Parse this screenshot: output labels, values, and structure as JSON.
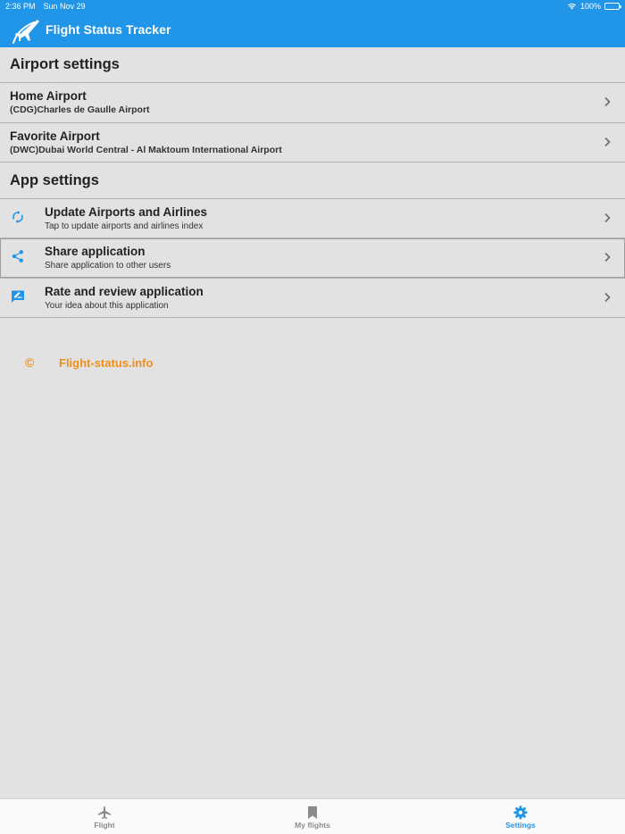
{
  "status_bar": {
    "time": "2:36 PM",
    "date": "Sun Nov 29",
    "battery": "100%"
  },
  "header": {
    "title": "Flight Status Tracker",
    "color": "#2196e8"
  },
  "airport_settings": {
    "title": "Airport settings",
    "items": [
      {
        "label": "Home Airport",
        "value": "(CDG)Charles de Gaulle Airport"
      },
      {
        "label": "Favorite Airport",
        "value": "(DWC)Dubai World Central - Al Maktoum International Airport"
      }
    ]
  },
  "app_settings": {
    "title": "App settings",
    "items": [
      {
        "label": "Update Airports and Airlines",
        "description": "Tap to update airports and airlines index",
        "icon": "sync-icon"
      },
      {
        "label": "Share application",
        "description": "Share application to other users",
        "icon": "share-icon"
      },
      {
        "label": "Rate and review application",
        "description": "Your idea about this application",
        "icon": "rate-review-icon"
      }
    ]
  },
  "copyright": {
    "symbol": "©",
    "text": "Flight-status.info",
    "color": "#ee8f1b"
  },
  "tabs": [
    {
      "label": "Flight",
      "icon": "airplane-icon",
      "active": false
    },
    {
      "label": "My flights",
      "icon": "bookmark-icon",
      "active": false
    },
    {
      "label": "Settings",
      "icon": "gear-icon",
      "active": true
    }
  ]
}
